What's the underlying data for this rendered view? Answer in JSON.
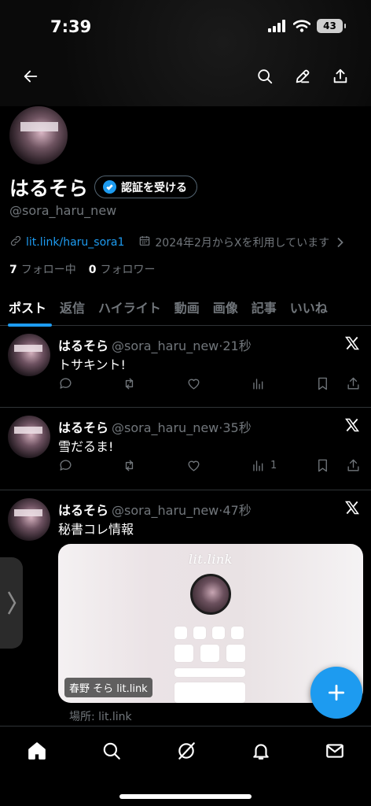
{
  "status_bar": {
    "time": "7:39",
    "battery": "43"
  },
  "profile": {
    "name": "はるそら",
    "verify_label": "認証を受ける",
    "handle": "@sora_haru_new",
    "link": "lit.link/haru_sora1",
    "joined": "2024年2月からXを利用しています",
    "following_count": "7",
    "following_label": "フォロー中",
    "followers_count": "0",
    "followers_label": "フォロワー"
  },
  "tabs": [
    "ポスト",
    "返信",
    "ハイライト",
    "動画",
    "画像",
    "記事",
    "いいね"
  ],
  "tweets": [
    {
      "name": "はるそら",
      "handle": "@sora_haru_new",
      "time": "·21秒",
      "text": "トサキント!",
      "views": ""
    },
    {
      "name": "はるそら",
      "handle": "@sora_haru_new",
      "time": "·35秒",
      "text": "雪だるま!",
      "views": "1"
    },
    {
      "name": "はるそら",
      "handle": "@sora_haru_new",
      "time": "·47秒",
      "text": "秘書コレ情報",
      "views": ""
    }
  ],
  "card": {
    "logo_text": "lit.link",
    "label": "春野 そら lit.link",
    "location": "場所: lit.link"
  },
  "icons": {
    "back": "arrow-left-icon",
    "search": "search-icon",
    "edit": "pencil-icon",
    "share": "share-icon",
    "nav": [
      "home-icon",
      "search-icon",
      "grok-icon",
      "bell-icon",
      "mail-icon"
    ]
  },
  "colors": {
    "accent": "#1d9bf0",
    "background": "#000000",
    "muted": "#71767b"
  }
}
